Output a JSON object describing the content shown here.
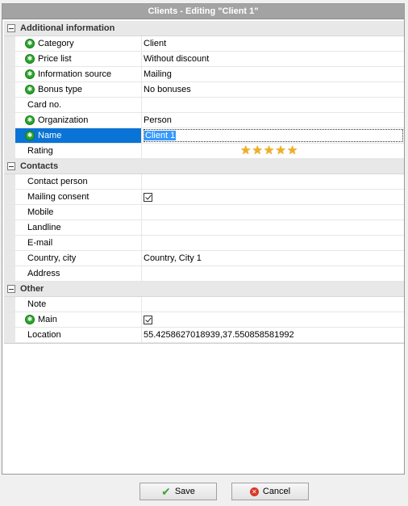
{
  "window": {
    "title": "Clients - Editing \"Client 1\""
  },
  "sections": {
    "additional": {
      "title": "Additional information",
      "rows": {
        "category": {
          "label": "Category",
          "value": "Client"
        },
        "price_list": {
          "label": "Price list",
          "value": "Without discount"
        },
        "info_source": {
          "label": "Information source",
          "value": "Mailing"
        },
        "bonus_type": {
          "label": "Bonus type",
          "value": "No bonuses"
        },
        "card_no": {
          "label": "Card no.",
          "value": ""
        },
        "organization": {
          "label": "Organization",
          "value": "Person"
        },
        "name": {
          "label": "Name",
          "value": "Client 1"
        },
        "rating": {
          "label": "Rating",
          "stars": 5
        }
      }
    },
    "contacts": {
      "title": "Contacts",
      "rows": {
        "contact_person": {
          "label": "Contact person",
          "value": ""
        },
        "mailing_consent": {
          "label": "Mailing consent",
          "checked": true
        },
        "mobile": {
          "label": "Mobile",
          "value": ""
        },
        "landline": {
          "label": "Landline",
          "value": ""
        },
        "email": {
          "label": "E-mail",
          "value": ""
        },
        "country_city": {
          "label": "Country, city",
          "value": "Country, City 1"
        },
        "address": {
          "label": "Address",
          "value": ""
        }
      }
    },
    "other": {
      "title": "Other",
      "rows": {
        "note": {
          "label": "Note",
          "value": ""
        },
        "main": {
          "label": "Main",
          "checked": true
        },
        "location": {
          "label": "Location",
          "value": "55.4258627018939,37.550858581992"
        }
      }
    }
  },
  "buttons": {
    "save": "Save",
    "cancel": "Cancel"
  },
  "colors": {
    "selection": "#0a74d6",
    "titlebar": "#a3a3a3",
    "required_icon": "#2aa52a"
  }
}
